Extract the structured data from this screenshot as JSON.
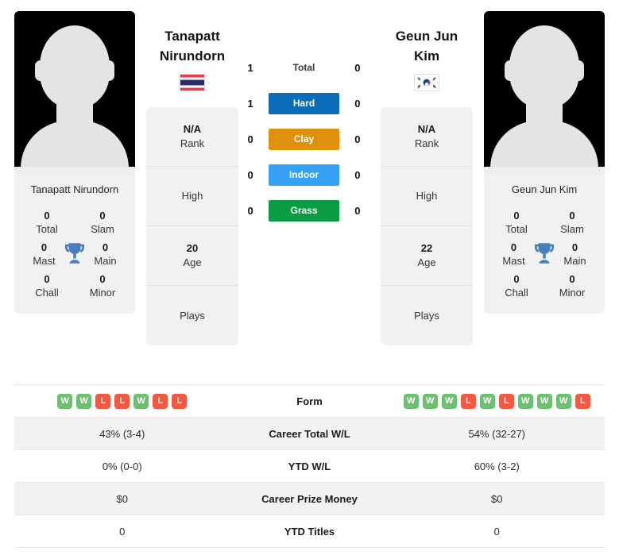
{
  "colors": {
    "win_badge": "#6fbf73",
    "loss_badge": "#f05a41",
    "hard": "#0b6cb8",
    "clay": "#e0910a",
    "indoor": "#35a1f5",
    "grass": "#0a9c43",
    "card_bg": "#f1f1f1",
    "trophy": "#4a7ebb"
  },
  "players": {
    "left": {
      "first_name": "Tanapatt",
      "last_name": "Nirundorn",
      "full_name": "Tanapatt Nirundorn",
      "flag": "thailand-flag",
      "flag_alt": "Thailand",
      "avatar": "player-avatar-placeholder",
      "info": [
        {
          "value": "N/A",
          "label": "Rank"
        },
        {
          "value": "",
          "label": "High"
        },
        {
          "value": "20",
          "label": "Age"
        },
        {
          "value": "",
          "label": "Plays"
        }
      ],
      "achievements": [
        {
          "value": "0",
          "label": "Total"
        },
        {
          "value": "0",
          "label": "Slam"
        },
        {
          "value": "0",
          "label": "Mast"
        },
        {
          "value": "0",
          "label": "Main"
        },
        {
          "value": "0",
          "label": "Chall"
        },
        {
          "value": "0",
          "label": "Minor"
        }
      ],
      "form": [
        "W",
        "W",
        "L",
        "L",
        "W",
        "L",
        "L"
      ],
      "career_total_wl": "43% (3-4)",
      "ytd_wl": "0% (0-0)",
      "career_prize_money": "$0",
      "ytd_titles": "0"
    },
    "right": {
      "first_name": "Geun Jun",
      "last_name": "Kim",
      "full_name": "Geun Jun Kim",
      "flag": "south-korea-flag",
      "flag_alt": "South Korea",
      "avatar": "player-avatar-placeholder",
      "info": [
        {
          "value": "N/A",
          "label": "Rank"
        },
        {
          "value": "",
          "label": "High"
        },
        {
          "value": "22",
          "label": "Age"
        },
        {
          "value": "",
          "label": "Plays"
        }
      ],
      "achievements": [
        {
          "value": "0",
          "label": "Total"
        },
        {
          "value": "0",
          "label": "Slam"
        },
        {
          "value": "0",
          "label": "Mast"
        },
        {
          "value": "0",
          "label": "Main"
        },
        {
          "value": "0",
          "label": "Chall"
        },
        {
          "value": "0",
          "label": "Minor"
        }
      ],
      "form": [
        "W",
        "W",
        "W",
        "L",
        "W",
        "L",
        "W",
        "W",
        "W",
        "L"
      ],
      "career_total_wl": "54% (32-27)",
      "ytd_wl": "60% (3-2)",
      "career_prize_money": "$0",
      "ytd_titles": "0"
    }
  },
  "head_to_head": {
    "rows": [
      {
        "label": "Total",
        "left": "1",
        "right": "0",
        "style": "plain",
        "color": ""
      },
      {
        "label": "Hard",
        "left": "1",
        "right": "0",
        "style": "filled",
        "color": "#0b6cb8"
      },
      {
        "label": "Clay",
        "left": "0",
        "right": "0",
        "style": "filled",
        "color": "#e0910a"
      },
      {
        "label": "Indoor",
        "left": "0",
        "right": "0",
        "style": "filled",
        "color": "#35a1f5"
      },
      {
        "label": "Grass",
        "left": "0",
        "right": "0",
        "style": "filled",
        "color": "#0a9c43"
      }
    ]
  },
  "stat_table": {
    "rows": [
      {
        "label": "Form",
        "left": "",
        "right": "",
        "type": "form"
      },
      {
        "label": "Career Total W/L",
        "left": "43% (3-4)",
        "right": "54% (32-27)",
        "type": "text"
      },
      {
        "label": "YTD W/L",
        "left": "0% (0-0)",
        "right": "60% (3-2)",
        "type": "text"
      },
      {
        "label": "Career Prize Money",
        "left": "$0",
        "right": "$0",
        "type": "text"
      },
      {
        "label": "YTD Titles",
        "left": "0",
        "right": "0",
        "type": "text"
      }
    ]
  }
}
